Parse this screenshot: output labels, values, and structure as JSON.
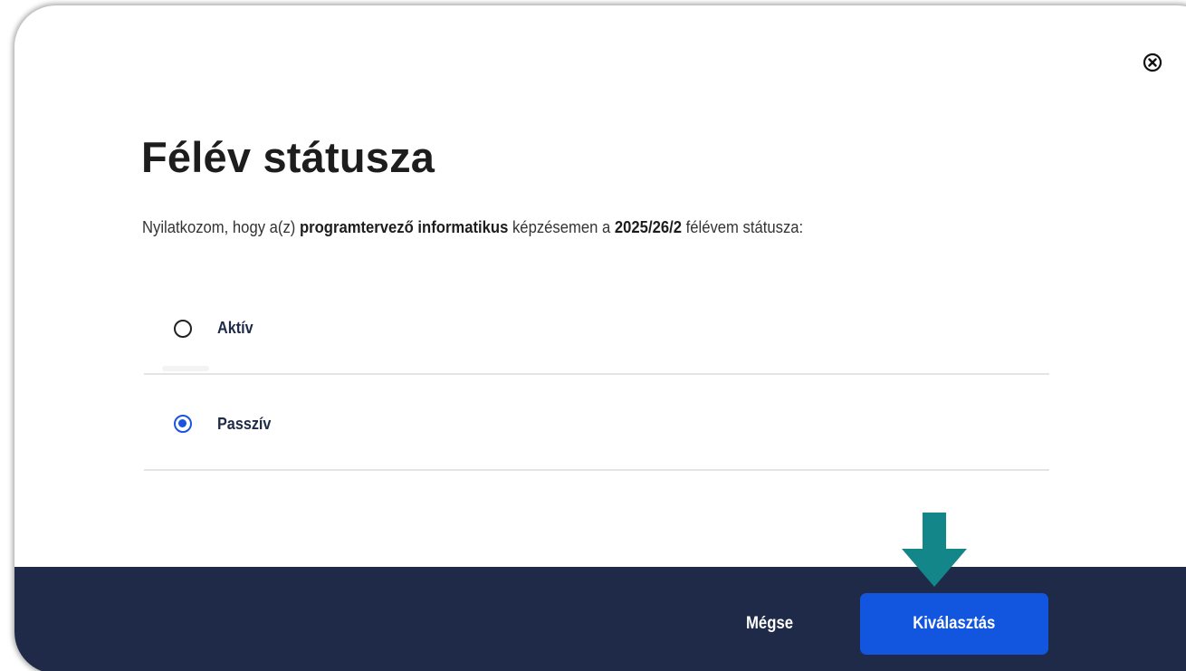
{
  "dialog": {
    "title": "Félév státusza",
    "statement": {
      "prefix": "Nyilatkozom, hogy a(z) ",
      "program": "programtervező informatikus",
      "middle": " képzésemen a ",
      "semester": "2025/26/2",
      "suffix": " félévem státusza:"
    },
    "options": [
      {
        "label": "Aktív",
        "selected": false
      },
      {
        "label": "Passzív",
        "selected": true
      }
    ],
    "cancel_label": "Mégse",
    "confirm_label": "Kiválasztás",
    "close_icon": "close-circle-icon",
    "annotation_icon": "arrow-down-icon"
  },
  "colors": {
    "footer_bg": "#1e2a47",
    "primary_button": "#1256e0",
    "radio_selected": "#1a55e0",
    "annotation_arrow": "#13868a"
  }
}
